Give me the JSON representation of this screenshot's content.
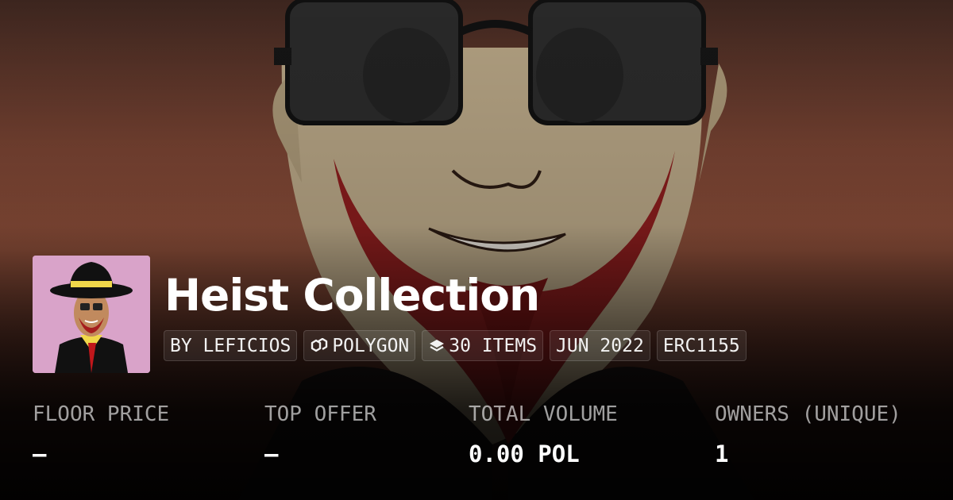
{
  "collection": {
    "title": "Heist Collection",
    "avatar_alt": "collection-avatar"
  },
  "chips": [
    {
      "label": "BY LEFICIOS",
      "icon": ""
    },
    {
      "label": "POLYGON",
      "icon": "polygon-chain-icon"
    },
    {
      "label": "30 ITEMS",
      "icon": "layers-icon"
    },
    {
      "label": "JUN 2022",
      "icon": ""
    },
    {
      "label": "ERC1155",
      "icon": ""
    }
  ],
  "stats": [
    {
      "label": "FLOOR PRICE",
      "value": "–"
    },
    {
      "label": "TOP OFFER",
      "value": "–"
    },
    {
      "label": "TOTAL VOLUME",
      "value": "0.00 POL"
    },
    {
      "label": "OWNERS (UNIQUE)",
      "value": "1"
    }
  ],
  "colors": {
    "text": "#ffffff",
    "label": "#b5b0ae",
    "banner_top": "#3f2720",
    "banner_mid": "#8c4e39",
    "avatar_bg": "#d9a3c9"
  }
}
